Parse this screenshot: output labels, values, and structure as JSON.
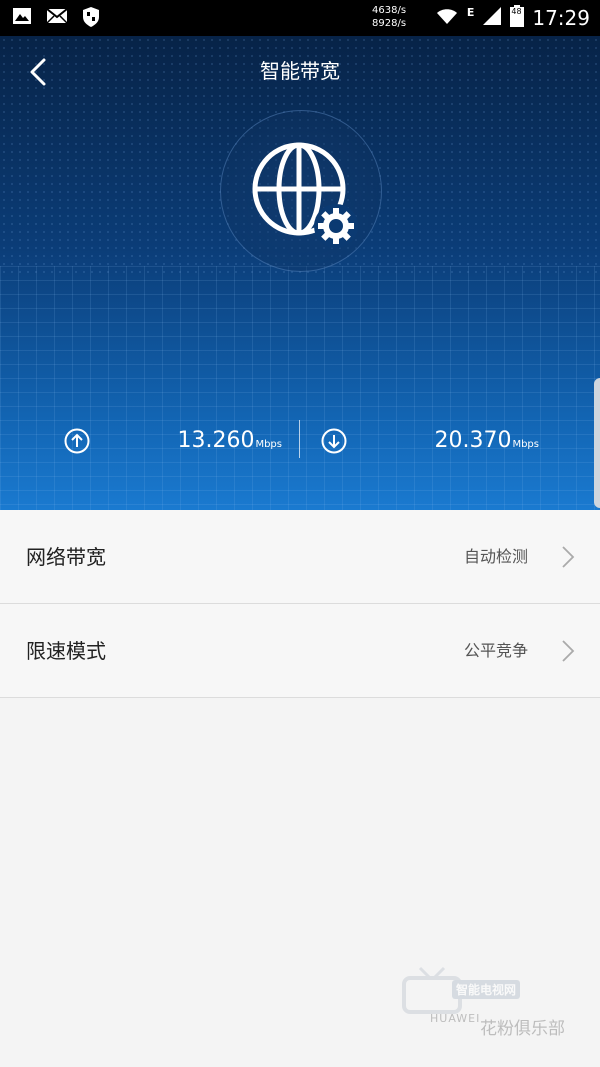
{
  "status_bar": {
    "net_speed_up": "4638/s",
    "net_speed_down": "8928/s",
    "network_type": "E",
    "battery_level": "48",
    "time": "17:29"
  },
  "header": {
    "title": "智能带宽"
  },
  "speed": {
    "upload_value": "13.260",
    "upload_unit": "Mbps",
    "download_value": "20.370",
    "download_unit": "Mbps"
  },
  "settings": {
    "items": [
      {
        "label": "网络带宽",
        "value": "自动检测"
      },
      {
        "label": "限速模式",
        "value": "公平竞争"
      }
    ]
  },
  "watermark": {
    "top_text": "智能电视网",
    "brand": "HUAWEI",
    "club": "花粉俱乐部"
  },
  "colors": {
    "hero_top": "#072347",
    "hero_bottom": "#1a7ad0",
    "list_background": "#f7f7f7"
  },
  "icons": [
    "image-icon",
    "mail-icon",
    "shield-icon",
    "wifi-icon",
    "signal-icon",
    "battery-icon",
    "back-chevron-icon",
    "globe-gear-icon",
    "upload-arrow-icon",
    "download-arrow-icon",
    "chevron-right-icon"
  ]
}
